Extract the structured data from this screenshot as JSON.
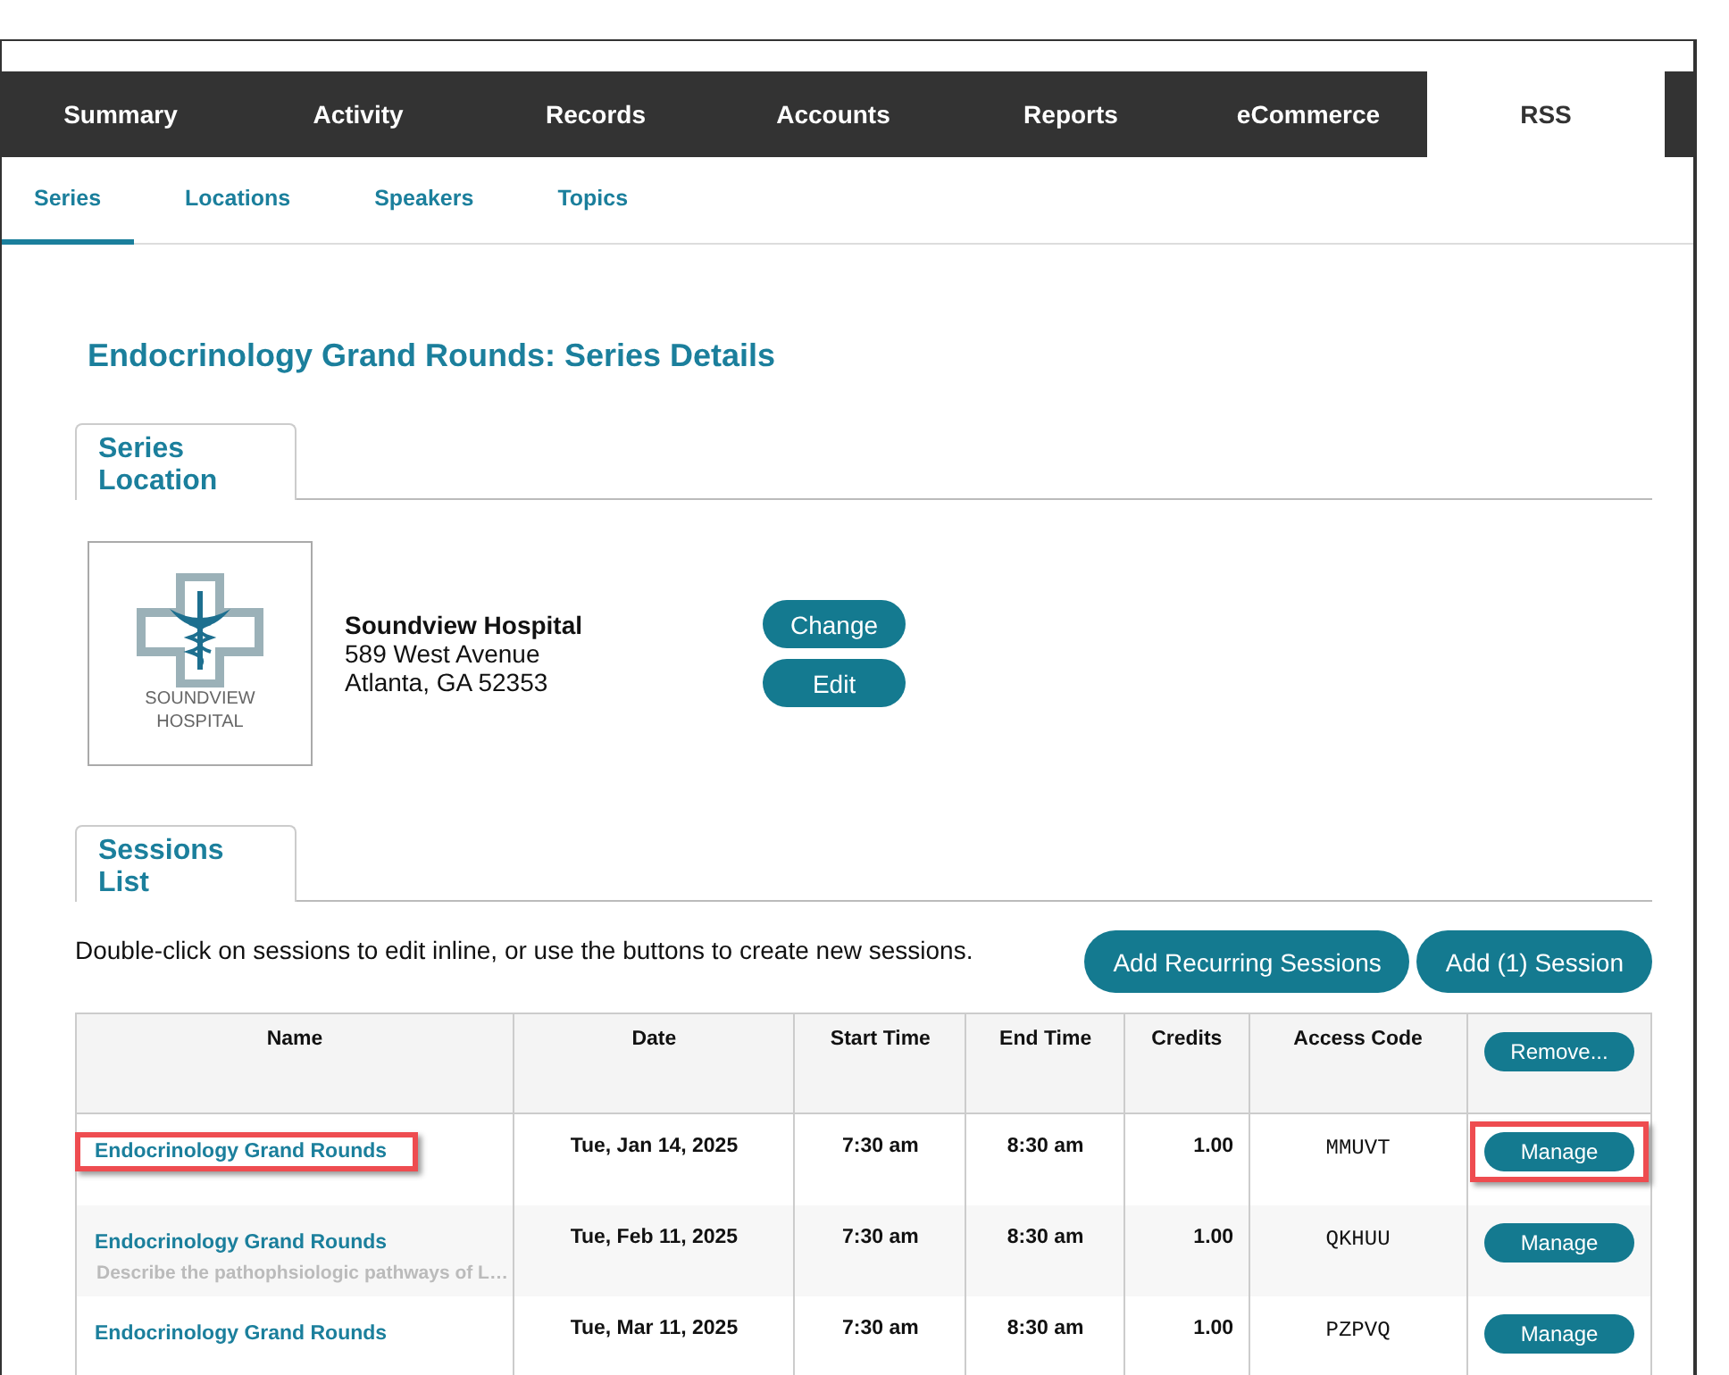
{
  "main_tabs": [
    {
      "label": "Summary",
      "selected": false
    },
    {
      "label": "Activity",
      "selected": false
    },
    {
      "label": "Records",
      "selected": false
    },
    {
      "label": "Accounts",
      "selected": false
    },
    {
      "label": "Reports",
      "selected": false
    },
    {
      "label": "eCommerce",
      "selected": false
    },
    {
      "label": "RSS",
      "selected": true
    }
  ],
  "sub_tabs": [
    {
      "label": "Series",
      "selected": true
    },
    {
      "label": "Locations",
      "selected": false
    },
    {
      "label": "Speakers",
      "selected": false
    },
    {
      "label": "Topics",
      "selected": false
    }
  ],
  "page_title": "Endocrinology Grand Rounds: Series Details",
  "location_section": {
    "tab": [
      "Series",
      "Location"
    ],
    "logo_text": [
      "SOUNDVIEW",
      "HOSPITAL"
    ],
    "name": "Soundview Hospital",
    "address": [
      "589 West Avenue",
      "Atlanta, GA 52353"
    ],
    "buttons": [
      "Change",
      "Edit"
    ]
  },
  "sessions_section": {
    "tab": [
      "Sessions",
      "List"
    ],
    "hint": "Double-click on sessions to edit inline, or use the buttons to create new sessions.",
    "buttons": [
      "Add Recurring Sessions",
      "Add (1) Session"
    ]
  },
  "table": {
    "columns": [
      "Name",
      "Date",
      "Start Time",
      "End Time",
      "Credits",
      "Access Code"
    ],
    "header_button": "Remove...",
    "rows": [
      {
        "name": "Endocrinology Grand Rounds",
        "description": "",
        "date": "Tue, Jan 14, 2025",
        "start": "7:30 am",
        "end": "8:30 am",
        "credits": "1.00",
        "code": "MMUVT",
        "action": "Manage",
        "callout": true
      },
      {
        "name": "Endocrinology Grand Rounds",
        "description": "Describe the pathophsiologic pathways of L…",
        "date": "Tue, Feb 11, 2025",
        "start": "7:30 am",
        "end": "8:30 am",
        "credits": "1.00",
        "code": "QKHUU",
        "action": "Manage",
        "callout": false
      },
      {
        "name": "Endocrinology Grand Rounds",
        "description": "",
        "date": "Tue, Mar 11, 2025",
        "start": "7:30 am",
        "end": "8:30 am",
        "credits": "1.00",
        "code": "PZPVQ",
        "action": "Manage",
        "callout": false
      }
    ]
  }
}
